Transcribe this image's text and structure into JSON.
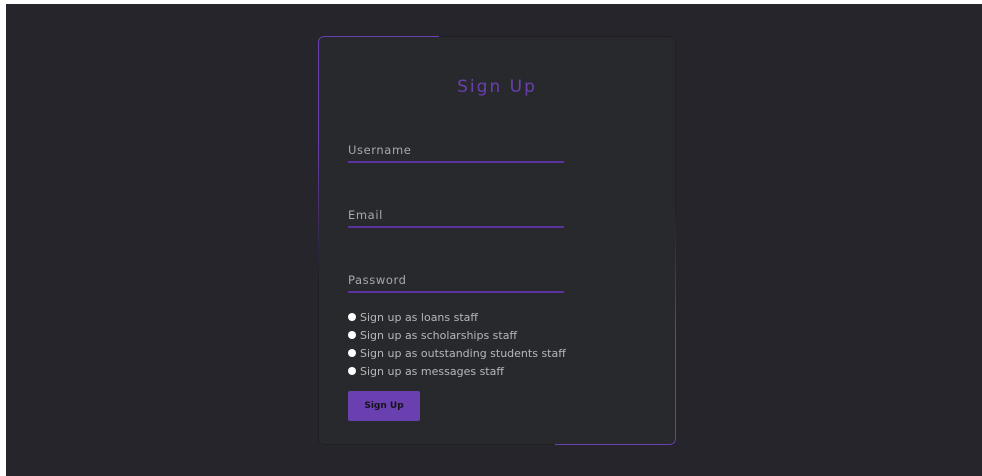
{
  "form": {
    "title": "Sign Up",
    "username": {
      "placeholder": "Username",
      "value": ""
    },
    "email": {
      "placeholder": "Email",
      "value": ""
    },
    "password": {
      "placeholder": "Password",
      "value": ""
    },
    "roles": [
      {
        "label": "Sign up as loans staff"
      },
      {
        "label": "Sign up as scholarships staff"
      },
      {
        "label": "Sign up as outstanding students staff"
      },
      {
        "label": "Sign up as messages staff"
      }
    ],
    "submit_label": "Sign Up"
  },
  "colors": {
    "page_background": "#25252b",
    "card_background": "#28292d",
    "accent": "#6a3fb0",
    "text_muted": "#a9a9ad",
    "radio": "#ffffff"
  }
}
